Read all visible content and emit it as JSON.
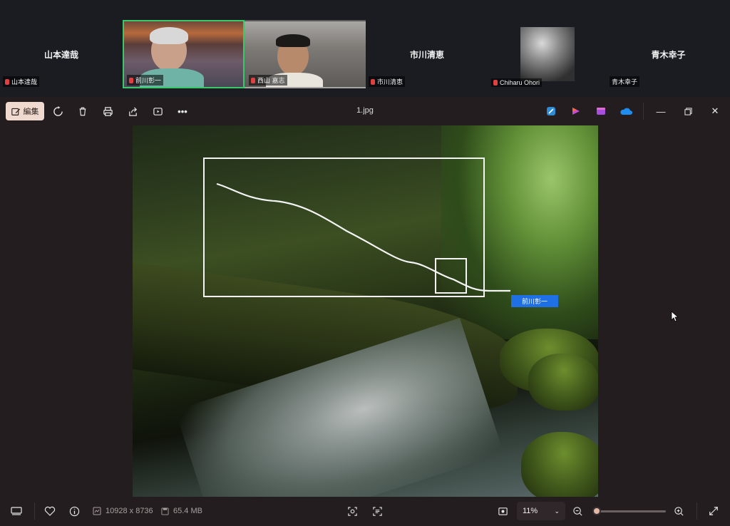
{
  "meeting": {
    "participants": [
      {
        "name": "山本達哉",
        "label": "山本達哉",
        "video": false
      },
      {
        "name": "前川彰一",
        "label": "前川彰一",
        "video": true,
        "active": true
      },
      {
        "name": "西山 嘉志",
        "label": "西山 嘉志",
        "video": true
      },
      {
        "name": "市川清恵",
        "label": "市川清恵",
        "video": false
      },
      {
        "name": "Chiharu Ohori",
        "label": "Chiharu Ohori",
        "video": true
      },
      {
        "name": "青木幸子",
        "label": "青木幸子",
        "video": false
      }
    ]
  },
  "toolbar": {
    "edit_label": "編集",
    "file_title": "1.jpg",
    "icons": [
      "rotate-icon",
      "delete-icon",
      "print-icon",
      "share-icon",
      "slideshow-icon",
      "more-icon"
    ],
    "app_icons": [
      "designer-icon",
      "clipchamp-icon",
      "collections-icon",
      "onedrive-icon"
    ]
  },
  "annotation": {
    "name_tag": "前川彰一",
    "color": "#f4f4f4",
    "tag_color": "#1f6fe5"
  },
  "statusbar": {
    "dimensions": "10928 x 8736",
    "file_size": "65.4 MB",
    "zoom": "11%",
    "zoom_fraction": 0.05
  },
  "colors": {
    "accent": "#f0d9cf",
    "active_border": "#39c86a"
  }
}
